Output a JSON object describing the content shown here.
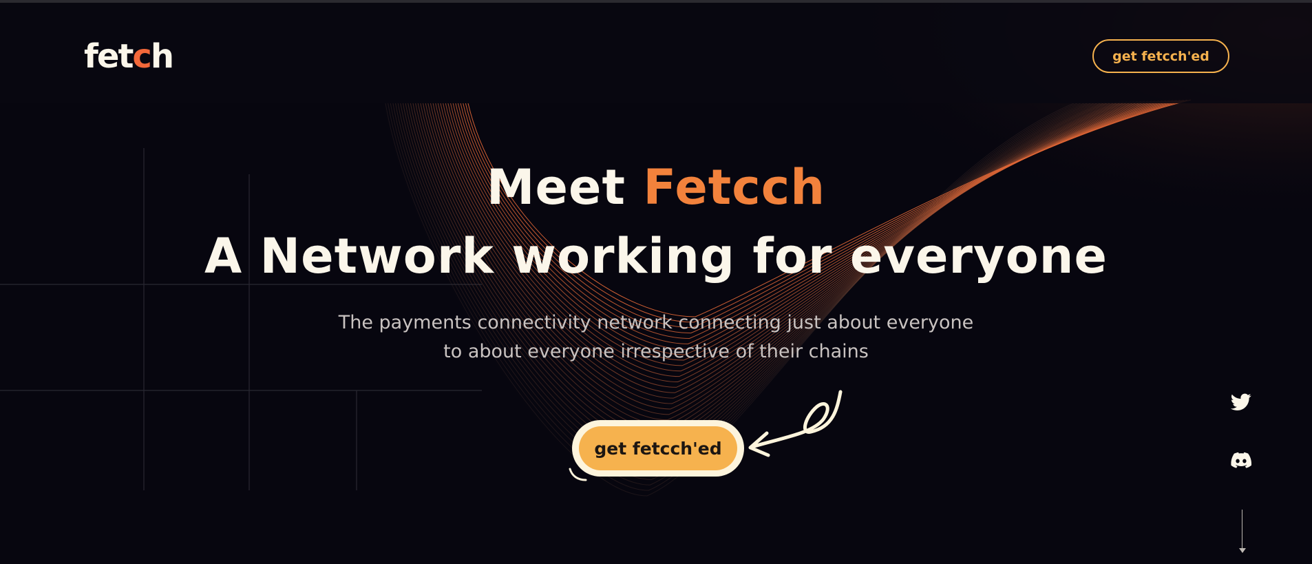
{
  "header": {
    "logo_parts": [
      "fet",
      "c",
      "h"
    ],
    "cta_label": "get fetcch'ed"
  },
  "hero": {
    "title_prefix": "Meet ",
    "title_accent": "Fetcch",
    "title_line2": "A Network working for everyone",
    "subtitle_line1": "The payments connectivity network connecting just about everyone",
    "subtitle_line2": "to about everyone irrespective of their chains",
    "cta_label": "get fetcch'ed"
  },
  "social": {
    "icons": [
      "twitter-icon",
      "discord-icon"
    ]
  },
  "colors": {
    "background": "#07060f",
    "accent_orange": "#f2823c",
    "accent_yellow": "#f6b24e",
    "text_light": "#fbf6ea"
  }
}
